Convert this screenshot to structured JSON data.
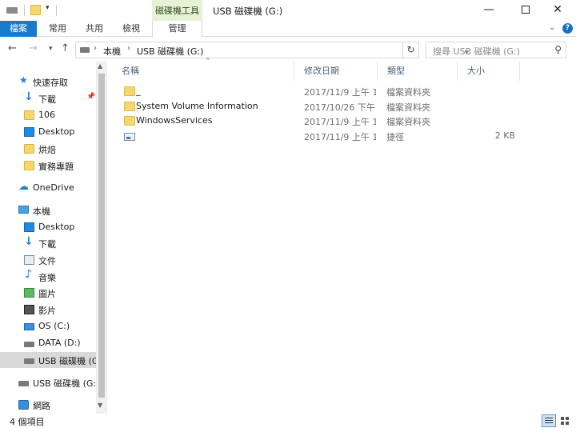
{
  "window": {
    "title": "USB 磁碟機 (G:)",
    "context_tab_group": "磁碟機工具",
    "minimize": "—",
    "close": "✕"
  },
  "ribbon": {
    "tabs": [
      "檔案",
      "常用",
      "共用",
      "檢視",
      "管理"
    ],
    "help": "?",
    "collapse": "⌄"
  },
  "address": {
    "crumbs": [
      "本機",
      "USB 磁碟機 (G:)"
    ],
    "refresh": "↻"
  },
  "search": {
    "placeholder": "搜尋 USB 磁碟機 (G:)",
    "icon": "search-icon"
  },
  "nav": {
    "quick_access": "快速存取",
    "items": [
      {
        "label": "下載",
        "icon": "download-icon"
      },
      {
        "label": "106",
        "icon": "folder-icon"
      },
      {
        "label": "Desktop",
        "icon": "desktop-icon"
      },
      {
        "label": "烘焙",
        "icon": "folder-icon"
      },
      {
        "label": "實務專題",
        "icon": "folder-icon"
      }
    ],
    "onedrive": "OneDrive",
    "this_pc": "本機",
    "pc_items": [
      {
        "label": "Desktop",
        "icon": "desktop-icon"
      },
      {
        "label": "下載",
        "icon": "download-icon"
      },
      {
        "label": "文件",
        "icon": "documents-icon"
      },
      {
        "label": "音樂",
        "icon": "music-icon"
      },
      {
        "label": "圖片",
        "icon": "pictures-icon"
      },
      {
        "label": "影片",
        "icon": "videos-icon"
      },
      {
        "label": "OS (C:)",
        "icon": "os-drive-icon"
      },
      {
        "label": "DATA (D:)",
        "icon": "drive-icon"
      },
      {
        "label": "USB 磁碟機 (G:)",
        "icon": "usb-drive-icon"
      }
    ],
    "usb_root": "USB 磁碟機 (G:)",
    "network": "網路"
  },
  "columns": {
    "name": "名稱",
    "date": "修改日期",
    "type": "類型",
    "size": "大小"
  },
  "files": [
    {
      "name": "_",
      "date": "2017/11/9 上午 1...",
      "type": "檔案資料夾",
      "size": "",
      "icon": "folder-icon"
    },
    {
      "name": "System Volume Information",
      "date": "2017/10/26 下午 ...",
      "type": "檔案資料夾",
      "size": "",
      "icon": "folder-icon"
    },
    {
      "name": "WindowsServices",
      "date": "2017/11/9 上午 1...",
      "type": "檔案資料夾",
      "size": "",
      "icon": "folder-icon"
    },
    {
      "name": "",
      "date": "2017/11/9 上午 1...",
      "type": "捷徑",
      "size": "2 KB",
      "icon": "shortcut-icon"
    }
  ],
  "status": {
    "item_count": "4 個項目"
  }
}
